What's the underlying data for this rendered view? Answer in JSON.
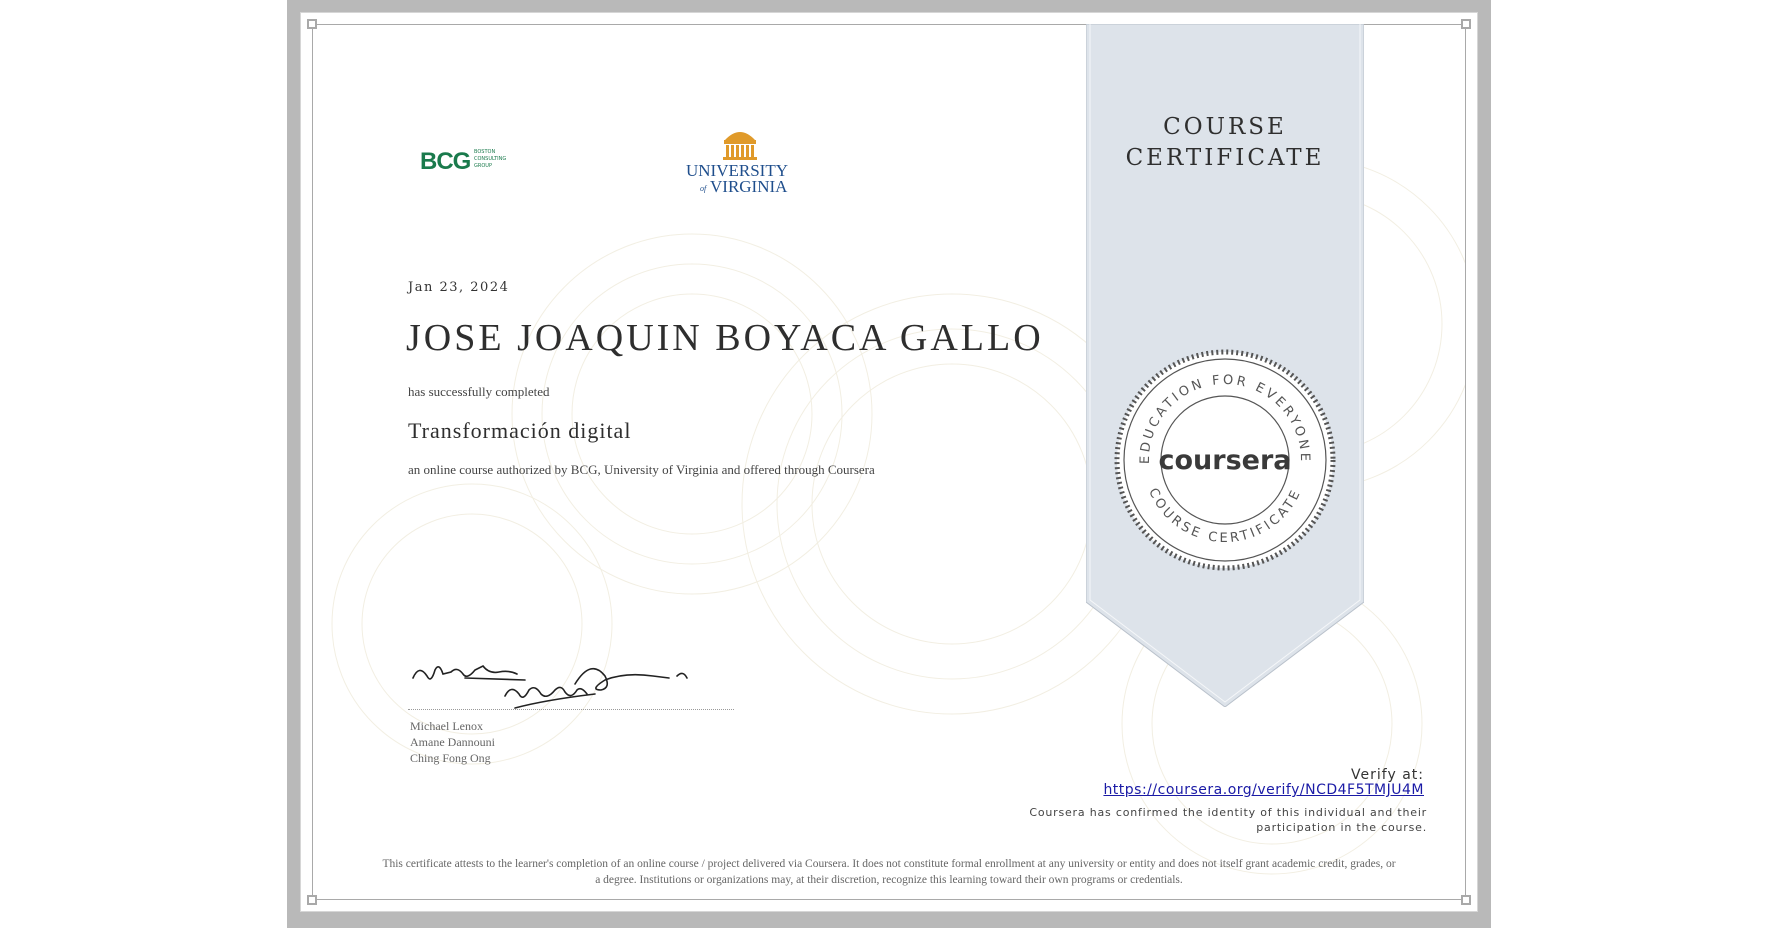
{
  "logos": {
    "bcg_mark": "BCG",
    "bcg_lines": [
      "BOSTON",
      "CONSULTING",
      "GROUP"
    ],
    "uva_line1": "UNIVERSITY",
    "uva_of": "of",
    "uva_line2": "VIRGINIA"
  },
  "certificate": {
    "date": "Jan 23, 2024",
    "recipient_name": "JOSE JOAQUIN BOYACA GALLO",
    "completed_text": "has successfully completed",
    "course_title": "Transformación digital",
    "authorization_text": "an online course authorized by BCG, University of Virginia and offered through Coursera"
  },
  "signers": [
    "Michael Lenox",
    "Amane Dannouni",
    "Ching Fong Ong"
  ],
  "ribbon": {
    "title_line1": "COURSE",
    "title_line2": "CERTIFICATE"
  },
  "seal": {
    "top_arc": "EDUCATION FOR EVERYONE",
    "bottom_arc": "COURSE CERTIFICATE",
    "brand": "coursera"
  },
  "verify": {
    "label": "Verify at:",
    "url": "https://coursera.org/verify/NCD4F5TMJU4M",
    "identity_line1": "Coursera has confirmed the identity of this individual and their",
    "identity_line2": "participation in the course."
  },
  "disclaimer": {
    "line1": "This certificate attests to the learner's completion of an online course / project delivered via Coursera. It does not constitute formal enrollment at any university or entity and does not itself grant academic credit, grades, or",
    "line2": "a degree. Institutions or organizations may, at their discretion, recognize this learning toward their own programs or credentials."
  },
  "colors": {
    "frame": "#b9b9b9",
    "ribbon": "#dde3ea",
    "bcg_green": "#1a7a4c",
    "uva_blue": "#1f4e8c",
    "uva_orange": "#e09a2a",
    "link": "#1a1aa6"
  }
}
